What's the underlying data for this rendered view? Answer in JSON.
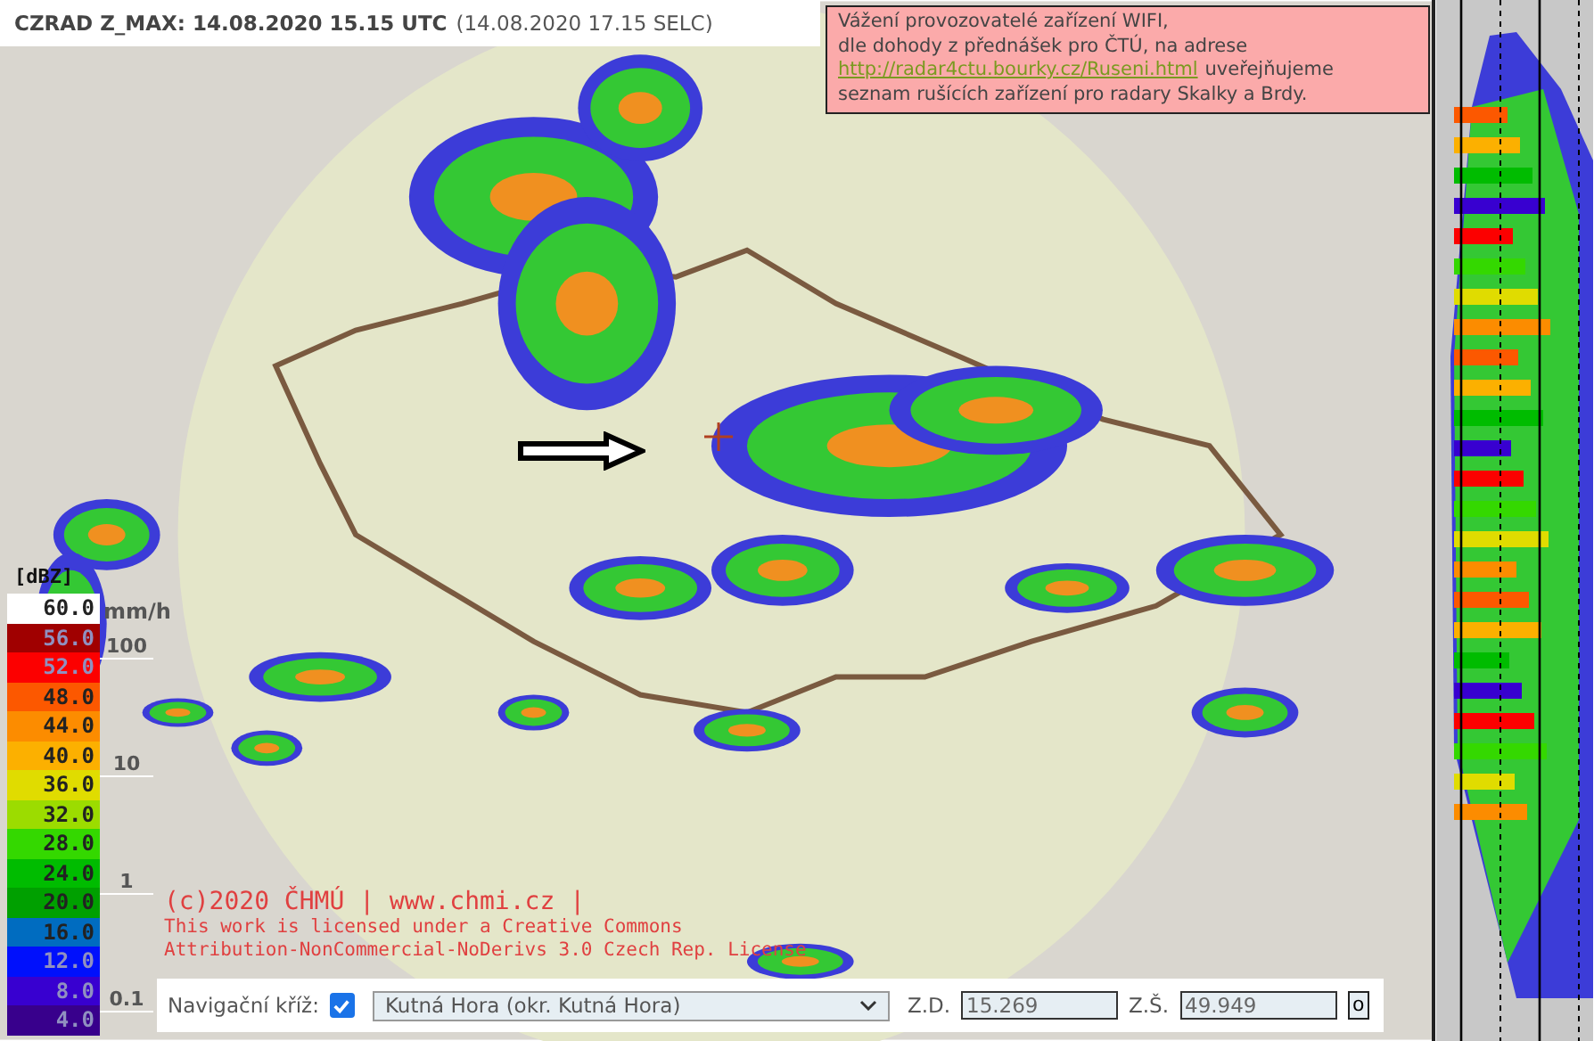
{
  "header": {
    "title": "CZRAD Z_MAX: 14.08.2020 15.15 UTC",
    "local_time": "(14.08.2020 17.15 SELC)"
  },
  "notice": {
    "line_1": "Vážení provozovatelé zařízení WIFI,",
    "line_2": "dle dohody z přednášek pro ČTÚ, na adrese",
    "link": "http://radar4ctu.bourky.cz/Ruseni.html",
    "line_3_rest": "uveřejňujeme",
    "line_4": "seznam rušících zařízení pro radary Skalky a Brdy."
  },
  "legend": {
    "unit": "[dBZ]",
    "items": [
      {
        "label": "60.0",
        "color": "#ffffff"
      },
      {
        "label": "56.0",
        "color": "#a00000"
      },
      {
        "label": "52.0",
        "color": "#fc0000"
      },
      {
        "label": "48.0",
        "color": "#fc5800"
      },
      {
        "label": "44.0",
        "color": "#fc8c00"
      },
      {
        "label": "40.0",
        "color": "#fcb000"
      },
      {
        "label": "36.0",
        "color": "#e0dc00"
      },
      {
        "label": "32.0",
        "color": "#9cdc00"
      },
      {
        "label": "28.0",
        "color": "#34d800"
      },
      {
        "label": "24.0",
        "color": "#00bc00"
      },
      {
        "label": "20.0",
        "color": "#00a000"
      },
      {
        "label": "16.0",
        "color": "#006cc0"
      },
      {
        "label": "12.0",
        "color": "#0010fc"
      },
      {
        "label": "8.0",
        "color": "#3800d0"
      },
      {
        "label": "4.0",
        "color": "#38008c"
      }
    ]
  },
  "rain_scale": {
    "unit": "mm/h",
    "ticks": [
      "100",
      "10",
      "1",
      "0.1"
    ]
  },
  "copyright": {
    "line_1": "(c)2020 ČHMÚ | www.chmi.cz |",
    "line_2": "This work is licensed under a Creative Commons",
    "line_3": "Attribution-NonCommercial-NoDerivs 3.0 Czech Rep. License"
  },
  "nav_bar": {
    "cross_label": "Navigační kříž:",
    "cross_checked": true,
    "place": "Kutná Hora (okr. Kutná Hora)",
    "lon_label": "Z.D.",
    "lon": "15.269",
    "lat_label": "Z.Š.",
    "lat": "49.949",
    "button": "o"
  }
}
